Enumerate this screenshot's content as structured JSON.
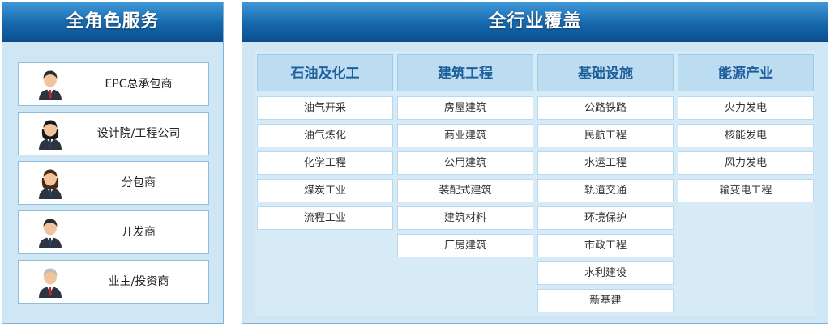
{
  "left_panel": {
    "title": "全角色服务",
    "roles": [
      {
        "label": "EPC总承包商",
        "icon": "businessman-red-tie-icon"
      },
      {
        "label": "设计院/工程公司",
        "icon": "businesswoman-icon"
      },
      {
        "label": "分包商",
        "icon": "businesswoman-icon"
      },
      {
        "label": "开发商",
        "icon": "businessman-icon"
      },
      {
        "label": "业主/投资商",
        "icon": "senior-businessman-icon"
      }
    ]
  },
  "right_panel": {
    "title": "全行业覆盖",
    "columns": [
      {
        "heading": "石油及化工",
        "items": [
          "油气开采",
          "油气炼化",
          "化学工程",
          "煤炭工业",
          "流程工业"
        ]
      },
      {
        "heading": "建筑工程",
        "items": [
          "房屋建筑",
          "商业建筑",
          "公用建筑",
          "装配式建筑",
          "建筑材料",
          "厂房建筑"
        ]
      },
      {
        "heading": "基础设施",
        "items": [
          "公路铁路",
          "民航工程",
          "水运工程",
          "轨道交通",
          "环境保护",
          "市政工程",
          "水利建设",
          "新基建"
        ]
      },
      {
        "heading": "能源产业",
        "items": [
          "火力发电",
          "核能发电",
          "风力发电",
          "输变电工程"
        ]
      }
    ]
  },
  "colors": {
    "header_blue": "#1668ad",
    "panel_bg": "#cfe6f5",
    "column_heading_text": "#1f5f9b"
  }
}
